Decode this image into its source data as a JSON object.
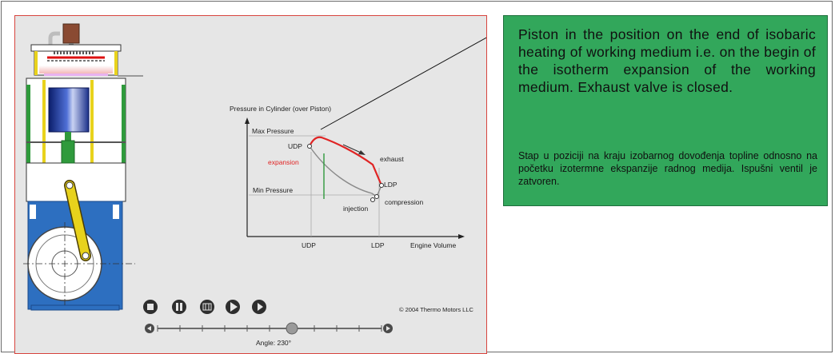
{
  "info": {
    "text_en": "Piston in the position on the end of isobaric heating of working medium i.e. on the begin of the isotherm expansion of the working medium. Exhaust valve is closed.",
    "text_hr": "Stap u poziciji na kraju izobarnog dovođenja topline odnosno na početku izotermne ekspanzije radnog medija. Ispušni ventil je zatvoren."
  },
  "diagram": {
    "y_title": "Pressure in Cylinder (over Piston)",
    "max_pressure": "Max Pressure",
    "min_pressure": "Min Pressure",
    "udp_curve": "UDP",
    "expansion": "expansion",
    "exhaust": "exhaust",
    "ldp_curve": "LDP",
    "compression": "compression",
    "injection": "injection",
    "udp_axis": "UDP",
    "ldp_axis": "LDP",
    "x_title": "Engine Volume"
  },
  "controls": {
    "copyright": "© 2004 Thermo Motors LLC",
    "angle_label": "Angle: 230°",
    "slider_value": 0.6
  },
  "icons": [
    "stop-icon",
    "pause-icon",
    "step-back-icon",
    "play-icon",
    "step-forward-icon",
    "rewind-icon",
    "fast-forward-icon"
  ],
  "colors": {
    "panel_bg": "#e6e6e6",
    "panel_border": "#d8443e",
    "info_bg": "#32a75b",
    "curve_hot": "#e02424",
    "curve_cold": "#8a8a8a",
    "engine_blue": "#2d6fc0",
    "engine_green": "#2f9a3c",
    "rod_yellow": "#e8d21c"
  }
}
